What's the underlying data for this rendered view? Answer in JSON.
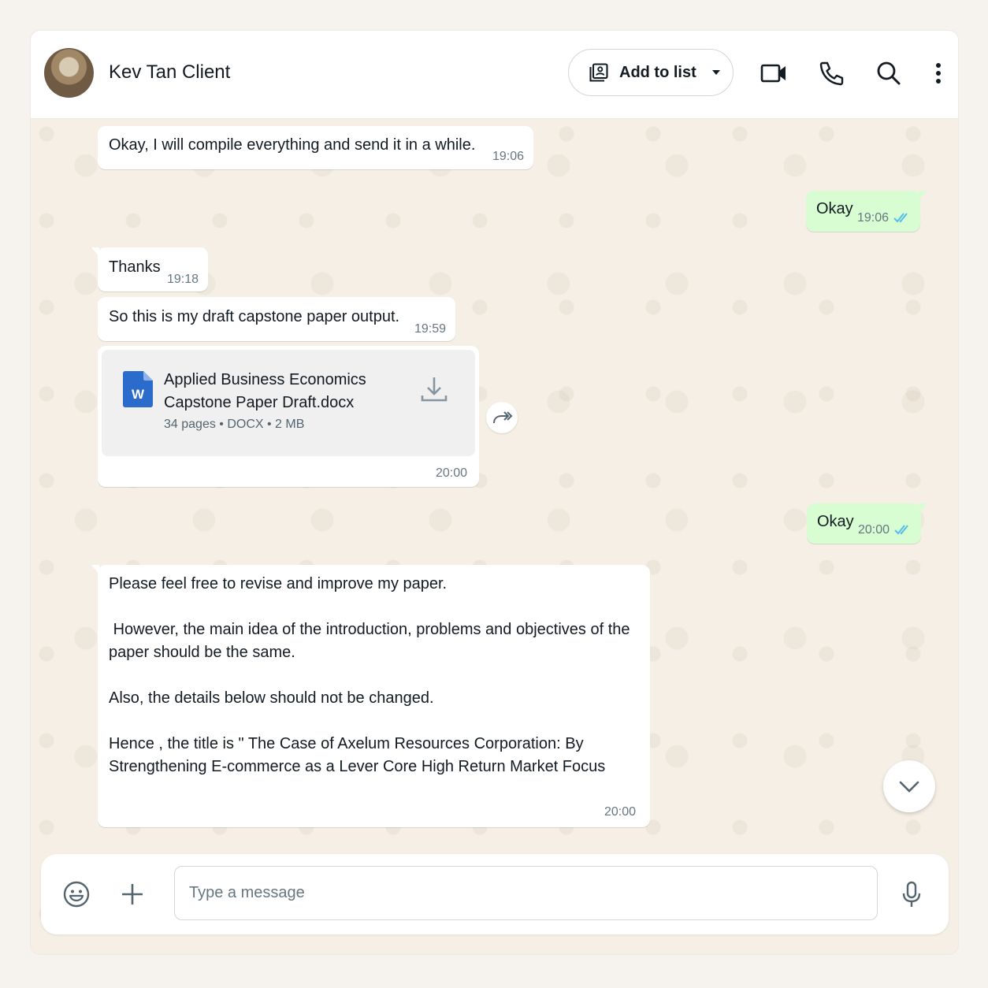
{
  "header": {
    "contact_name": "Kev Tan Client",
    "add_to_list_label": "Add to list",
    "icons": [
      "contact-list-icon",
      "caret-down-icon",
      "video-call-icon",
      "phone-icon",
      "search-icon",
      "more-vertical-icon"
    ]
  },
  "messages": [
    {
      "direction": "in",
      "text": "Okay, I will compile everything and send it in a while.",
      "time": "19:06"
    },
    {
      "direction": "out",
      "text": "Okay",
      "time": "19:06",
      "read": true
    },
    {
      "direction": "in",
      "text": "Thanks",
      "time": "19:18"
    },
    {
      "direction": "in",
      "text": "So this is my draft capstone paper output.",
      "time": "19:59"
    },
    {
      "direction": "in",
      "type": "document",
      "file_name_line1": "Applied Business Economics",
      "file_name_line2": "Capstone Paper Draft.docx",
      "meta": "34 pages • DOCX • 2 MB",
      "time": "20:00"
    },
    {
      "direction": "out",
      "text": "Okay",
      "time": "20:00",
      "read": true
    },
    {
      "direction": "in",
      "text": "Please feel free to revise and improve my paper.\n\n However, the main idea of the introduction, problems and objectives of the paper should be the same.\n\nAlso, the details below should not be changed.\n\nHence , the title is \" The Case of Axelum Resources Corporation: By Strengthening E-commerce as a Lever Core High Return Market Focus",
      "time": "20:00"
    }
  ],
  "composer": {
    "placeholder": "Type a message",
    "value": ""
  },
  "colors": {
    "incoming_bubble": "#ffffff",
    "outgoing_bubble": "#d9fdd3",
    "read_ticks": "#53bdeb",
    "chat_background": "#f5efe5"
  }
}
